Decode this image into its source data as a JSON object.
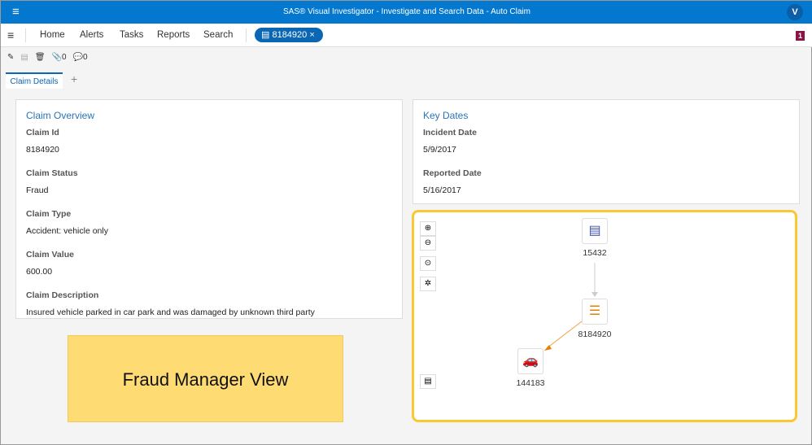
{
  "header": {
    "title": "SAS® Visual Investigator - Investigate and Search Data - Auto Claim",
    "logo": "V"
  },
  "nav": {
    "items": [
      "Home",
      "Alerts",
      "Tasks",
      "Reports",
      "Search"
    ],
    "open_tab": "8184920",
    "badge": "1"
  },
  "toolbar": {
    "attachments": "0",
    "comments": "0"
  },
  "tabs": {
    "active": "Claim Details"
  },
  "overview": {
    "title": "Claim Overview",
    "fields": [
      {
        "label": "Claim Id",
        "value": "8184920"
      },
      {
        "label": "Claim Status",
        "value": "Fraud"
      },
      {
        "label": "Claim Type",
        "value": "Accident: vehicle only"
      },
      {
        "label": "Claim Value",
        "value": "600.00"
      },
      {
        "label": "Claim Description",
        "value": "Insured vehicle parked in car park and was damaged by unknown third party"
      }
    ]
  },
  "dates": {
    "title": "Key Dates",
    "fields": [
      {
        "label": "Incident Date",
        "value": "5/9/2017"
      },
      {
        "label": "Reported Date",
        "value": "5/16/2017"
      }
    ]
  },
  "banner": "Fraud Manager View",
  "graph": {
    "nodes": [
      {
        "id": "15432",
        "icon": "policy-icon",
        "color": "#3f51b5"
      },
      {
        "id": "8184920",
        "icon": "claim-icon",
        "color": "#e67e00"
      },
      {
        "id": "144183",
        "icon": "car-icon",
        "color": "#4caf50"
      }
    ]
  }
}
